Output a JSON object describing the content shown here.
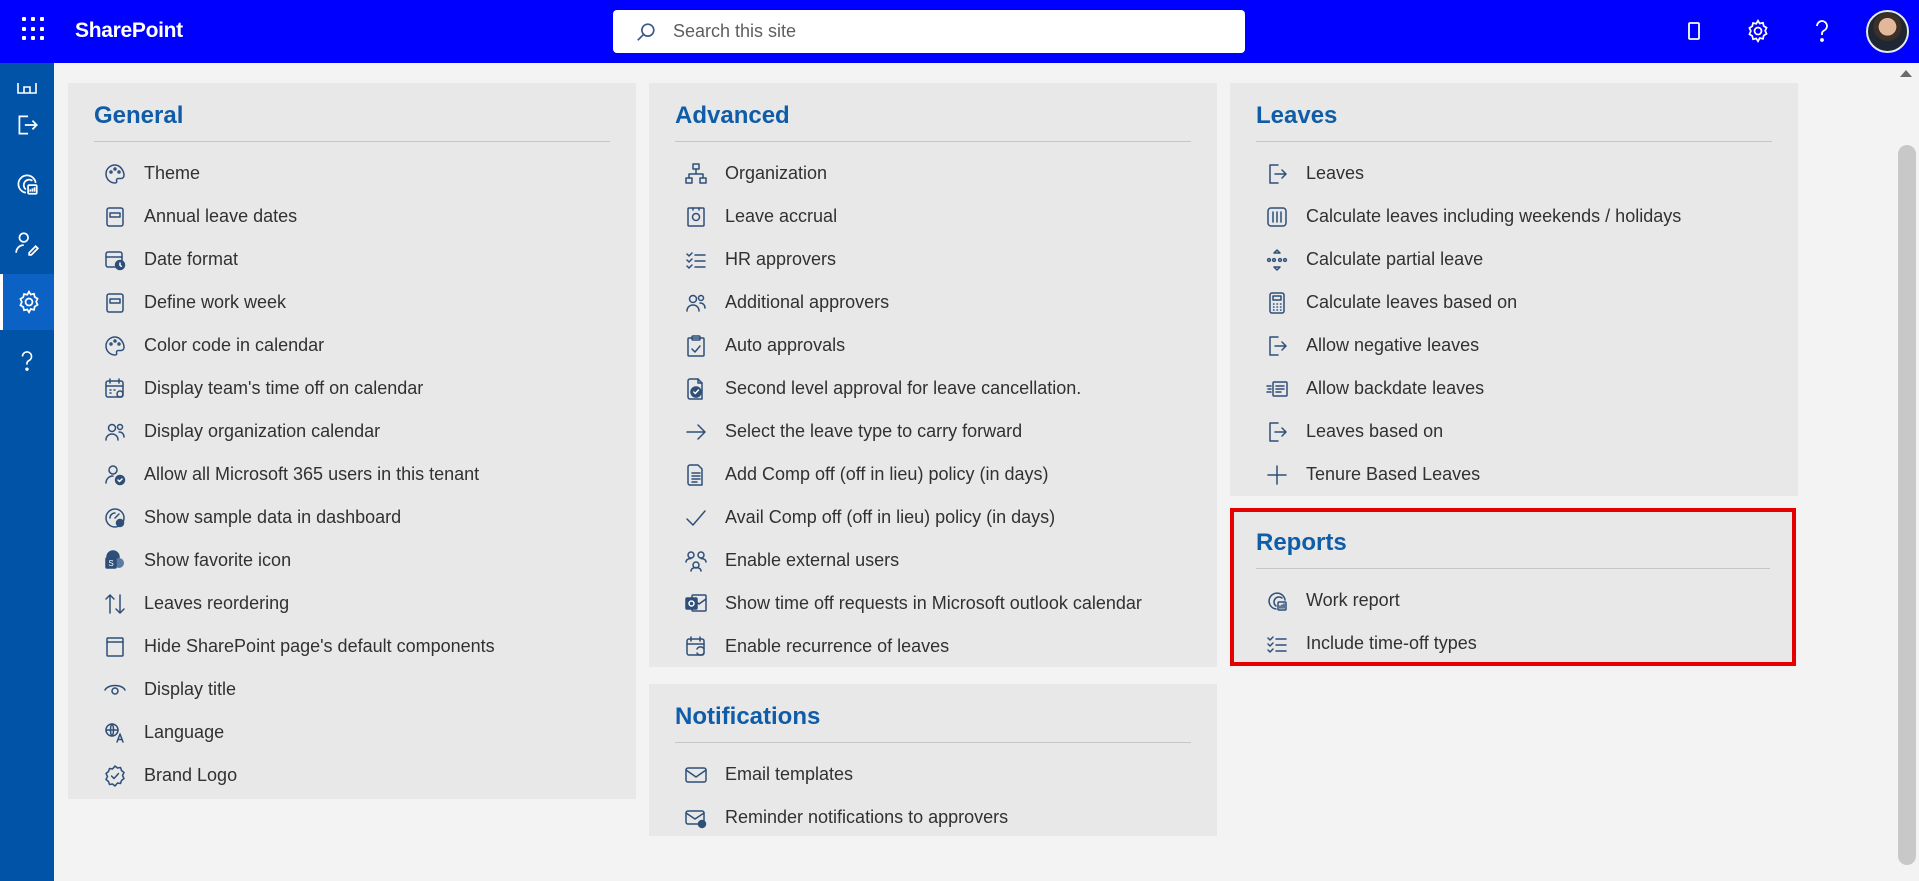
{
  "header": {
    "brand": "SharePoint",
    "search_placeholder": "Search this site",
    "icons": [
      "app-launcher-icon",
      "mobile-icon",
      "settings-gear-icon",
      "help-icon"
    ]
  },
  "rail": {
    "icons": [
      "home-icon",
      "exit-icon",
      "report-icon",
      "user-edit-icon",
      "settings-icon",
      "help-icon"
    ]
  },
  "sections": {
    "general": {
      "title": "General",
      "items": [
        {
          "label": "Theme",
          "icon": "palette-icon"
        },
        {
          "label": "Annual leave dates",
          "icon": "form-icon"
        },
        {
          "label": "Date format",
          "icon": "calendar-clock-icon"
        },
        {
          "label": "Define work week",
          "icon": "form-icon"
        },
        {
          "label": "Color code in calendar",
          "icon": "palette-icon"
        },
        {
          "label": "Display team's time off on calendar",
          "icon": "calendar-settings-icon"
        },
        {
          "label": "Display organization calendar",
          "icon": "people-icon"
        },
        {
          "label": "Allow all Microsoft 365 users in this tenant",
          "icon": "user-check-icon"
        },
        {
          "label": "Show sample data in dashboard",
          "icon": "gauge-icon"
        },
        {
          "label": "Show favorite icon",
          "icon": "sharepoint-icon"
        },
        {
          "label": "Leaves reordering",
          "icon": "sort-icon"
        },
        {
          "label": "Hide SharePoint page's default components",
          "icon": "page-icon"
        },
        {
          "label": "Display title",
          "icon": "eye-icon"
        },
        {
          "label": "Language",
          "icon": "translate-icon"
        },
        {
          "label": "Brand Logo",
          "icon": "badge-icon"
        }
      ]
    },
    "advanced": {
      "title": "Advanced",
      "items": [
        {
          "label": "Organization",
          "icon": "org-chart-icon"
        },
        {
          "label": "Leave accrual",
          "icon": "safe-icon"
        },
        {
          "label": "HR approvers",
          "icon": "checklist-icon"
        },
        {
          "label": "Additional approvers",
          "icon": "people-icon"
        },
        {
          "label": "Auto approvals",
          "icon": "clipboard-icon"
        },
        {
          "label": "Second level approval for leave cancellation.",
          "icon": "doc-check-icon"
        },
        {
          "label": "Select the leave type to carry forward",
          "icon": "arrow-right-icon"
        },
        {
          "label": "Add Comp off (off in lieu) policy (in days)",
          "icon": "document-lines-icon"
        },
        {
          "label": "Avail Comp off (off in lieu) policy (in days)",
          "icon": "checkmark-icon"
        },
        {
          "label": "Enable external users",
          "icon": "people-network-icon"
        },
        {
          "label": "Show time off requests in Microsoft outlook calendar",
          "icon": "outlook-icon"
        },
        {
          "label": "Enable recurrence of leaves",
          "icon": "calendar-sync-icon"
        }
      ]
    },
    "notifications": {
      "title": "Notifications",
      "items": [
        {
          "label": "Email templates",
          "icon": "mail-icon"
        },
        {
          "label": "Reminder notifications to approvers",
          "icon": "mail-alert-icon"
        }
      ]
    },
    "leaves": {
      "title": "Leaves",
      "items": [
        {
          "label": "Leaves",
          "icon": "exit-icon"
        },
        {
          "label": "Calculate leaves including weekends / holidays",
          "icon": "calendar-columns-icon"
        },
        {
          "label": "Calculate partial leave",
          "icon": "dots-arrows-icon"
        },
        {
          "label": "Calculate leaves based on",
          "icon": "calculator-icon"
        },
        {
          "label": "Allow negative leaves",
          "icon": "exit-icon"
        },
        {
          "label": "Allow backdate leaves",
          "icon": "backdate-icon"
        },
        {
          "label": "Leaves based on",
          "icon": "exit-icon"
        },
        {
          "label": "Tenure Based Leaves",
          "icon": "plus-icon"
        }
      ]
    },
    "reports": {
      "title": "Reports",
      "items": [
        {
          "label": "Work report",
          "icon": "report-icon"
        },
        {
          "label": "Include time-off types",
          "icon": "checklist-icon"
        }
      ]
    }
  },
  "colors": {
    "topbar": "#0000ff",
    "rail": "#0053a6",
    "section_title": "#0f5ca8",
    "highlight": "#e60000"
  }
}
